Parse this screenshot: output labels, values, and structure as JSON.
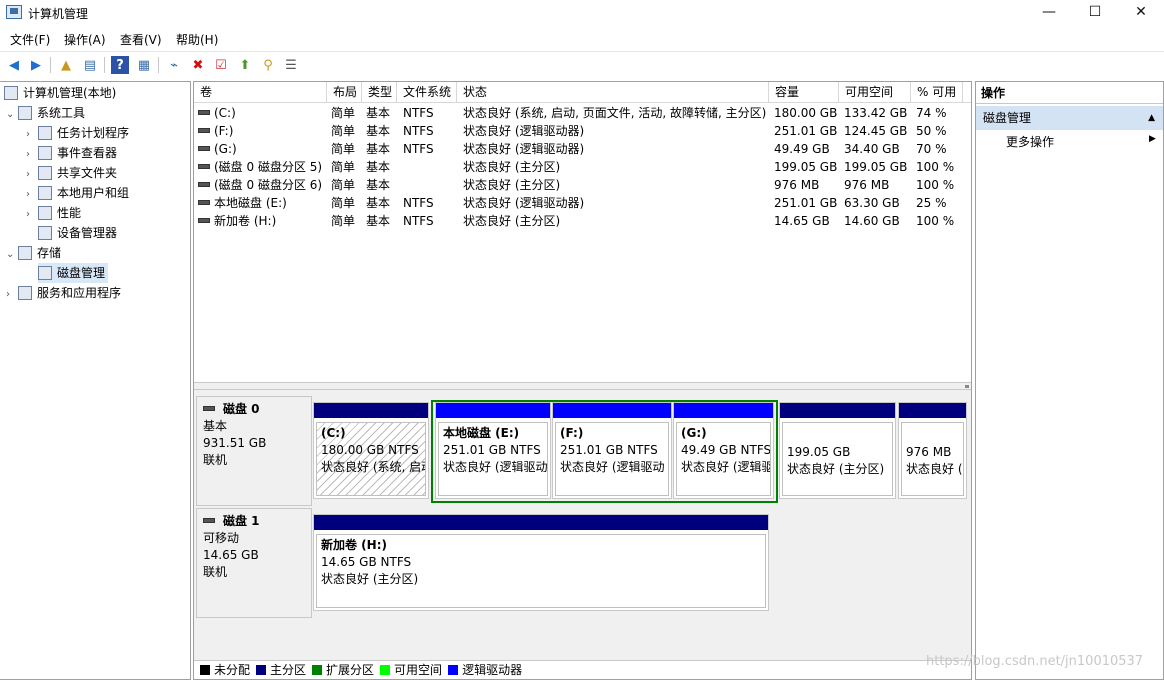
{
  "window": {
    "title": "计算机管理",
    "minimize": "—",
    "maximize": "☐",
    "close": "✕"
  },
  "menu": [
    "文件(F)",
    "操作(A)",
    "查看(V)",
    "帮助(H)"
  ],
  "toolbar_icons": [
    "back-arrow-icon",
    "forward-arrow-icon",
    "up-folder-icon",
    "show-hide-tree-icon",
    "help-icon",
    "properties-icon",
    "connect-icon",
    "delete-icon",
    "checklist-icon",
    "export-icon",
    "search-icon",
    "list-icon"
  ],
  "tree": {
    "root": "计算机管理(本地)",
    "system_tools": "系统工具",
    "task_scheduler": "任务计划程序",
    "event_viewer": "事件查看器",
    "shared_folders": "共享文件夹",
    "local_users": "本地用户和组",
    "performance": "性能",
    "device_manager": "设备管理器",
    "storage": "存储",
    "disk_management": "磁盘管理",
    "services_apps": "服务和应用程序"
  },
  "volume_table": {
    "headers": [
      "卷",
      "布局",
      "类型",
      "文件系统",
      "状态",
      "容量",
      "可用空间",
      "% 可用"
    ],
    "rows": [
      [
        "(C:)",
        "简单",
        "基本",
        "NTFS",
        "状态良好 (系统, 启动, 页面文件, 活动, 故障转储, 主分区)",
        "180.00 GB",
        "133.42 GB",
        "74 %"
      ],
      [
        "(F:)",
        "简单",
        "基本",
        "NTFS",
        "状态良好 (逻辑驱动器)",
        "251.01 GB",
        "124.45 GB",
        "50 %"
      ],
      [
        "(G:)",
        "简单",
        "基本",
        "NTFS",
        "状态良好 (逻辑驱动器)",
        "49.49 GB",
        "34.40 GB",
        "70 %"
      ],
      [
        "(磁盘 0 磁盘分区 5)",
        "简单",
        "基本",
        "",
        "状态良好 (主分区)",
        "199.05 GB",
        "199.05 GB",
        "100 %"
      ],
      [
        "(磁盘 0 磁盘分区 6)",
        "简单",
        "基本",
        "",
        "状态良好 (主分区)",
        "976 MB",
        "976 MB",
        "100 %"
      ],
      [
        "本地磁盘 (E:)",
        "简单",
        "基本",
        "NTFS",
        "状态良好 (逻辑驱动器)",
        "251.01 GB",
        "63.30 GB",
        "25 %"
      ],
      [
        "新加卷 (H:)",
        "简单",
        "基本",
        "NTFS",
        "状态良好 (主分区)",
        "14.65 GB",
        "14.60 GB",
        "100 %"
      ]
    ]
  },
  "disks": [
    {
      "name": "磁盘 0",
      "type": "基本",
      "size": "931.51 GB",
      "status": "联机",
      "partitions": [
        {
          "title": "(C:)",
          "size": "180.00 GB NTFS",
          "status": "状态良好 (系统, 启动",
          "bar": "#00007f"
        },
        {
          "title": "本地磁盘  (E:)",
          "size": "251.01 GB NTFS",
          "status": "状态良好 (逻辑驱动",
          "bar": "#0000ff"
        },
        {
          "title": "(F:)",
          "size": "251.01 GB NTFS",
          "status": "状态良好 (逻辑驱动",
          "bar": "#0000ff"
        },
        {
          "title": "(G:)",
          "size": "49.49 GB NTFS",
          "status": "状态良好 (逻辑驱",
          "bar": "#0000ff"
        },
        {
          "title": "",
          "size": "199.05 GB",
          "status": "状态良好 (主分区)",
          "bar": "#00007f"
        },
        {
          "title": "",
          "size": "976 MB",
          "status": "状态良好 (",
          "bar": "#00007f"
        }
      ]
    },
    {
      "name": "磁盘 1",
      "type": "可移动",
      "size": "14.65 GB",
      "status": "联机",
      "partitions": [
        {
          "title": "新加卷  (H:)",
          "size": "14.65 GB NTFS",
          "status": "状态良好 (主分区)",
          "bar": "#00007f"
        }
      ]
    }
  ],
  "legend": [
    {
      "label": "未分配",
      "color": "#000000"
    },
    {
      "label": "主分区",
      "color": "#00007f"
    },
    {
      "label": "扩展分区",
      "color": "#008000"
    },
    {
      "label": "可用空间",
      "color": "#00ff00"
    },
    {
      "label": "逻辑驱动器",
      "color": "#0000ff"
    }
  ],
  "actions": {
    "title": "操作",
    "section": "磁盘管理",
    "more": "更多操作"
  },
  "watermark": "https://blog.csdn.net/jn10010537"
}
